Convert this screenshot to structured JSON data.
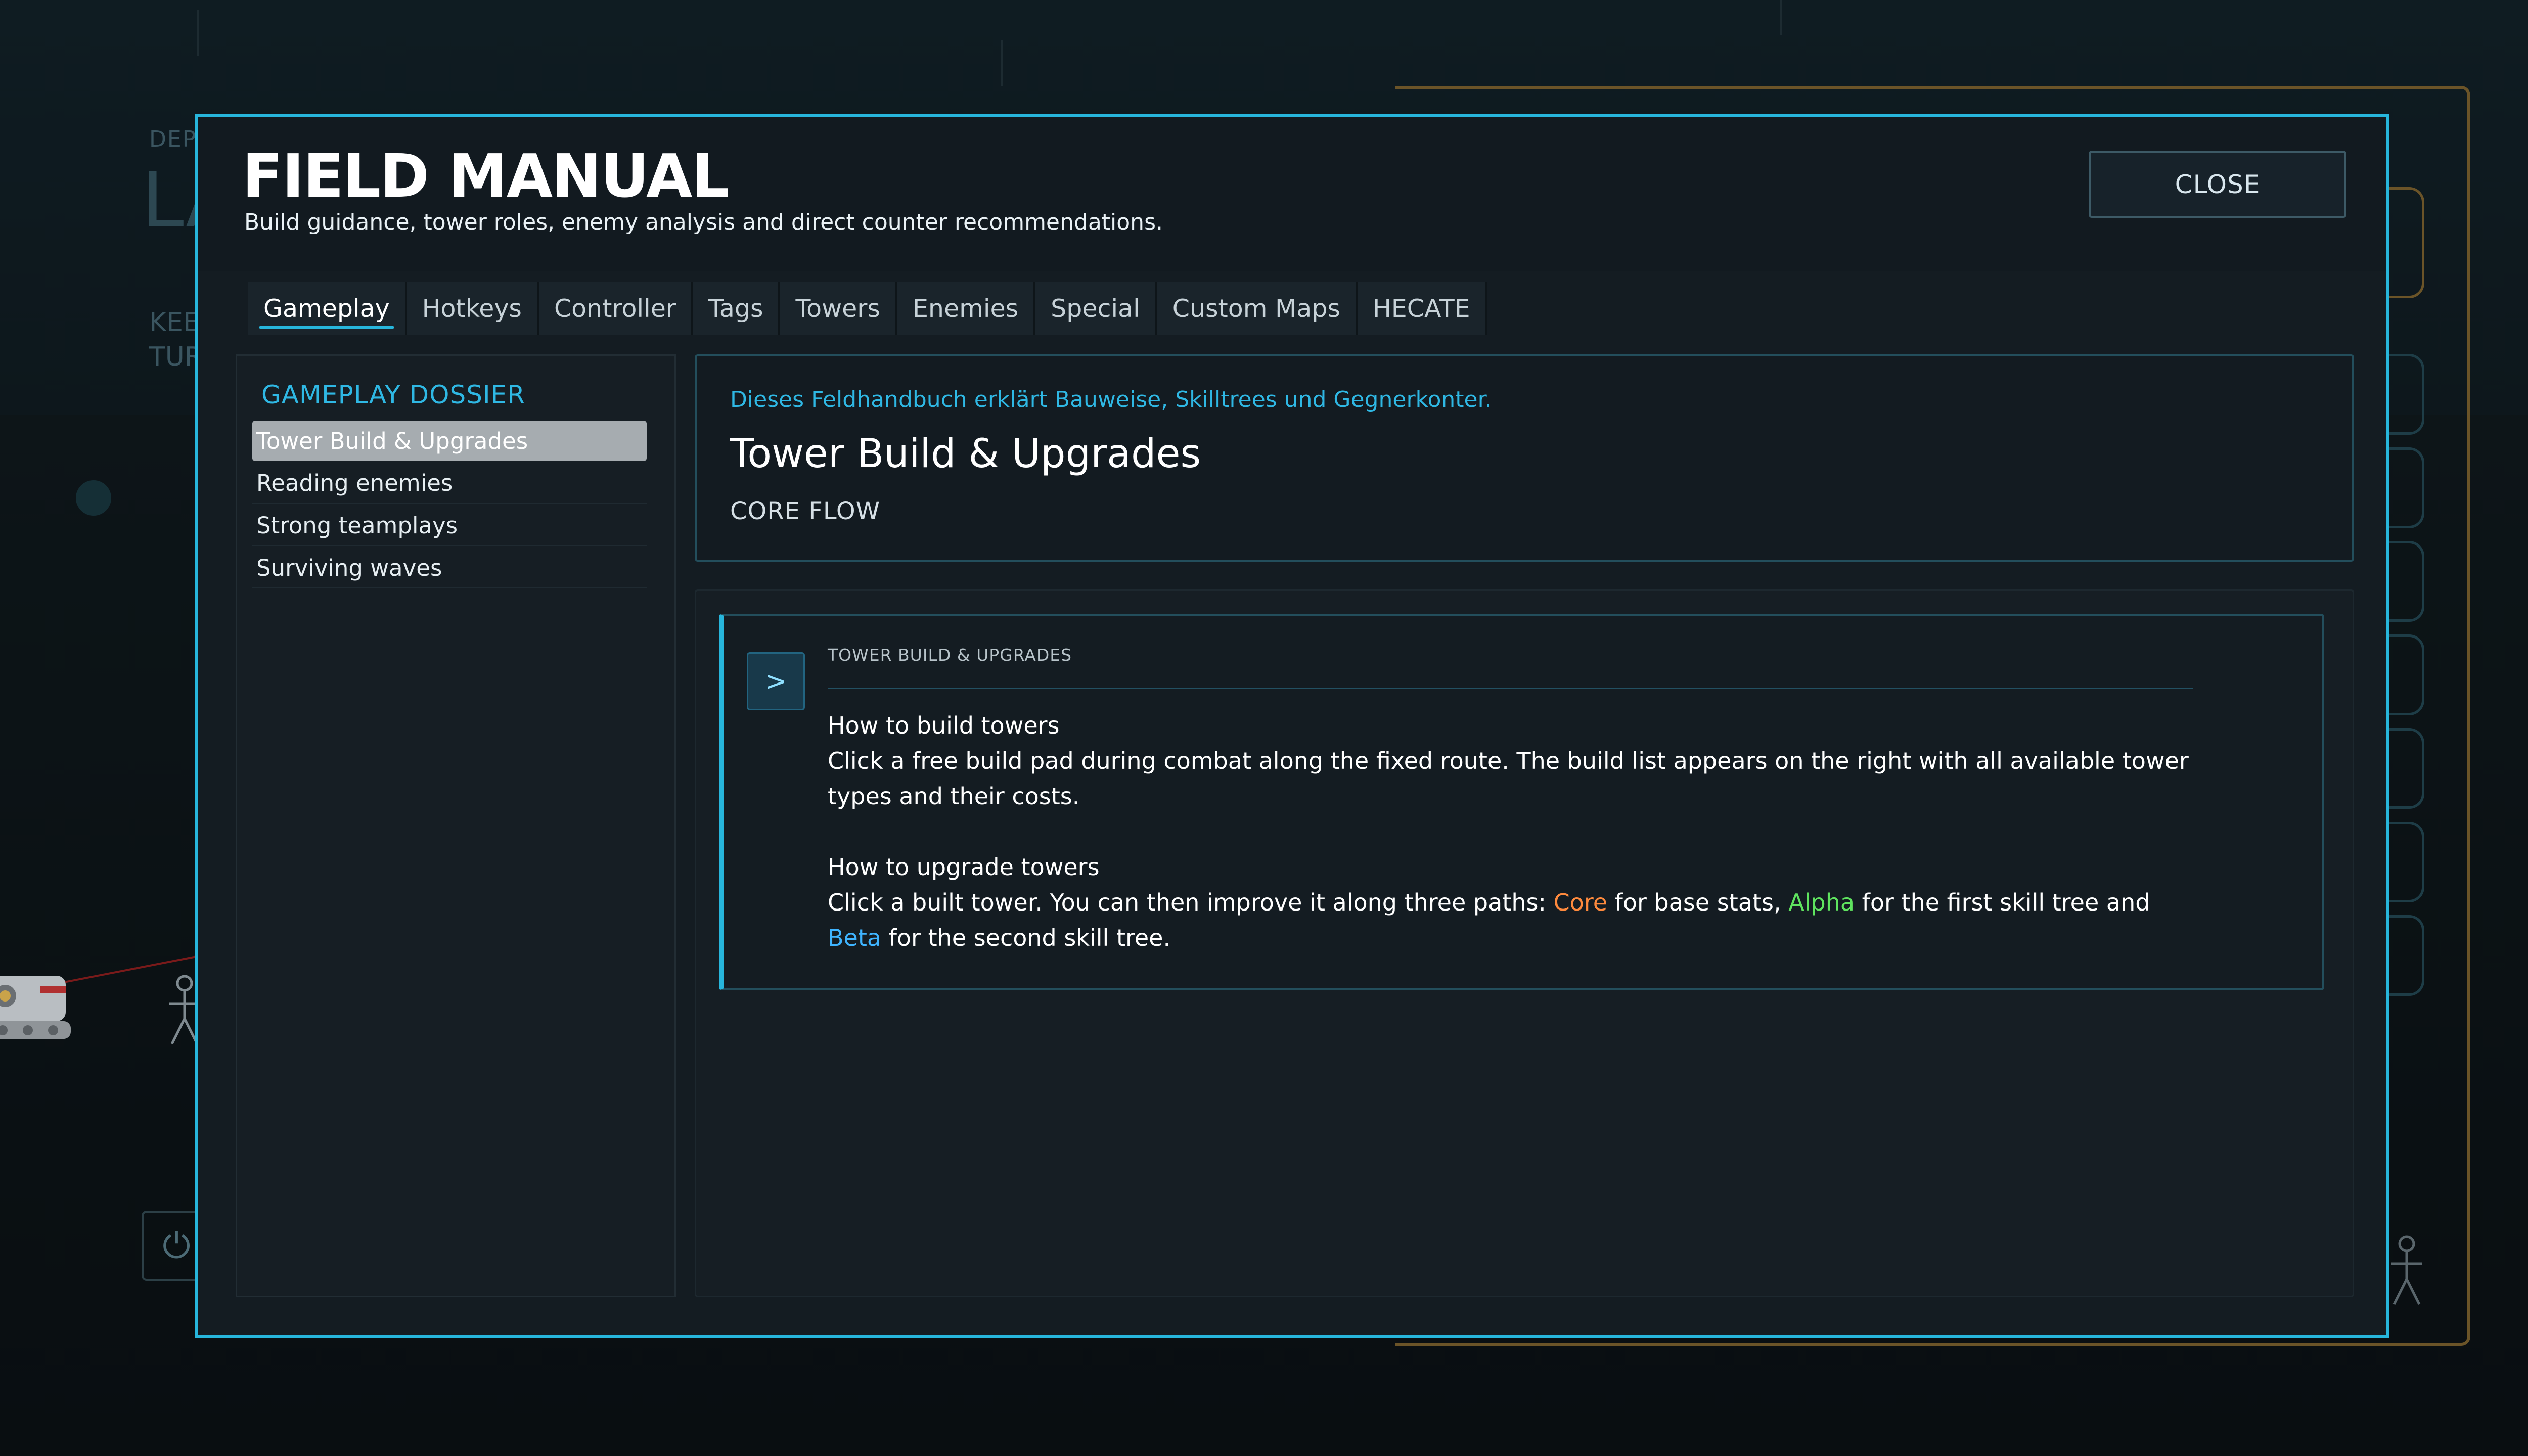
{
  "background": {
    "deploy_label": "DEPL",
    "big_label": "LA",
    "keep_label": "KEE",
    "turret_label": "TUR"
  },
  "modal": {
    "title": "FIELD MANUAL",
    "subtitle": "Build guidance, tower roles, enemy analysis and direct counter recommendations.",
    "close_label": "CLOSE"
  },
  "tabs": [
    {
      "label": "Gameplay",
      "active": true
    },
    {
      "label": "Hotkeys"
    },
    {
      "label": "Controller"
    },
    {
      "label": "Tags"
    },
    {
      "label": "Towers"
    },
    {
      "label": "Enemies"
    },
    {
      "label": "Special"
    },
    {
      "label": "Custom Maps"
    },
    {
      "label": "HECATE"
    }
  ],
  "sidebar": {
    "title": "GAMEPLAY DOSSIER",
    "items": [
      {
        "label": "Tower Build & Upgrades",
        "active": true
      },
      {
        "label": "Reading enemies"
      },
      {
        "label": "Strong teamplays"
      },
      {
        "label": "Surviving waves"
      }
    ]
  },
  "info": {
    "lead": "Dieses Feldhandbuch erklärt Bauweise, Skilltrees und Gegnerkonter.",
    "title": "Tower Build & Upgrades",
    "tag": "CORE FLOW"
  },
  "entry": {
    "icon": "chevron-right-icon",
    "icon_glyph": ">",
    "heading": "TOWER BUILD & UPGRADES",
    "build_title": "How to build towers",
    "build_text": "Click a free build pad during combat along the fixed route. The build list appears on the right with all available tower types and their costs.",
    "upgrade_title": "How to upgrade towers",
    "upgrade_text_1": "Click a built tower. You can then improve it along three paths: ",
    "core": "Core",
    "upgrade_text_2": " for base stats, ",
    "alpha": "Alpha",
    "upgrade_text_3": " for the first skill tree and ",
    "beta": "Beta",
    "upgrade_text_4": " for the second skill tree."
  },
  "colors": {
    "accent": "#27b6dc",
    "core": "#ff8a3d",
    "alpha": "#5fe35f",
    "beta": "#3fb4ff"
  }
}
